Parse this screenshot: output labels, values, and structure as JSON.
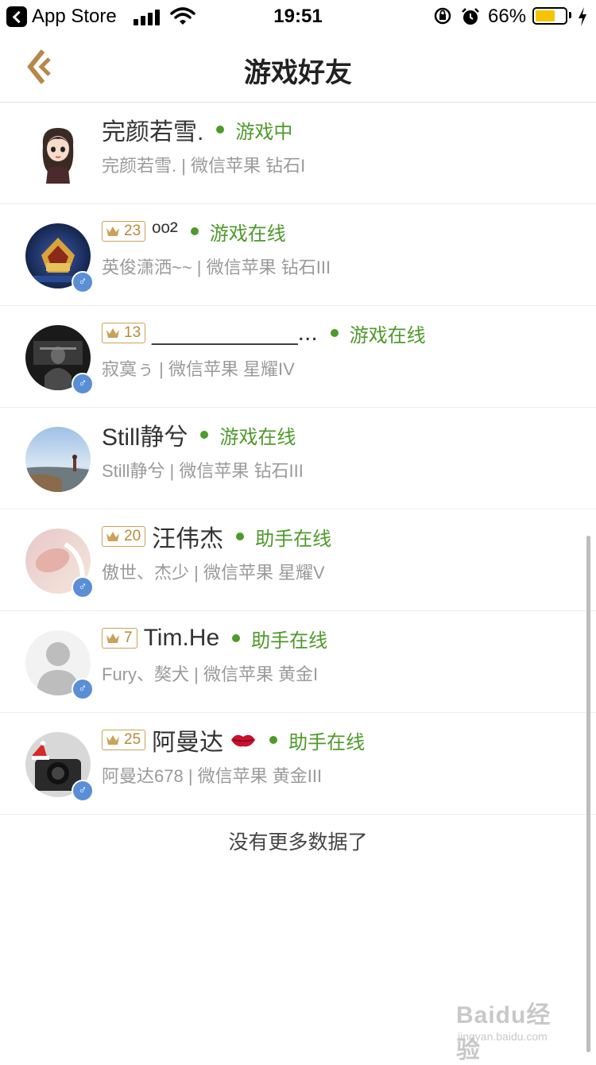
{
  "status_bar": {
    "back_app": "App Store",
    "time": "19:51",
    "battery_pct": "66%",
    "battery_level": 0.66
  },
  "nav": {
    "title": "游戏好友",
    "back_icon": "back-arrow-icon"
  },
  "friends": [
    {
      "level": "",
      "name": "完颜若雪.",
      "status": "游戏中",
      "detail": "完颜若雪. | 微信苹果 钻石I",
      "avatar": "cartoon-girl",
      "gender": ""
    },
    {
      "level": "23",
      "name": "ᵒᵒ²",
      "status": "游戏在线",
      "detail": "英俊潇洒~~ | 微信苹果 钻石III",
      "avatar": "game-emblem",
      "gender": "♂"
    },
    {
      "level": "13",
      "name": "___________...",
      "status": "游戏在线",
      "detail": "寂寞ぅ | 微信苹果 星耀IV",
      "avatar": "dark-portrait",
      "gender": "♂"
    },
    {
      "level": "",
      "name": "Still静兮",
      "status": "游戏在线",
      "detail": "Still静兮 | 微信苹果 钻石III",
      "avatar": "sky-landscape",
      "gender": ""
    },
    {
      "level": "20",
      "name": "汪伟杰",
      "status": "助手在线",
      "detail": "傲世、杰少 | 微信苹果 星耀V",
      "avatar": "pink-photo",
      "gender": "♂"
    },
    {
      "level": "7",
      "name": "Tim.He",
      "status": "助手在线",
      "detail": "Fury、獒犬 | 微信苹果 黄金I",
      "avatar": "default-person",
      "gender": "♂"
    },
    {
      "level": "25",
      "name": "阿曼达",
      "status": "助手在线",
      "detail": "阿曼达678 | 微信苹果 黄金III",
      "avatar": "camera-photo",
      "gender": "♂",
      "emoji": "kiss-lips-icon"
    }
  ],
  "footer": {
    "no_more": "没有更多数据了"
  },
  "watermark": {
    "main": "Baidu经验",
    "sub": "jingyan.baidu.com"
  },
  "colors": {
    "online_green": "#4e9a2b",
    "level_gold": "#b58a3a",
    "male_blue": "#5a8fd6",
    "battery": "#f5c400"
  }
}
